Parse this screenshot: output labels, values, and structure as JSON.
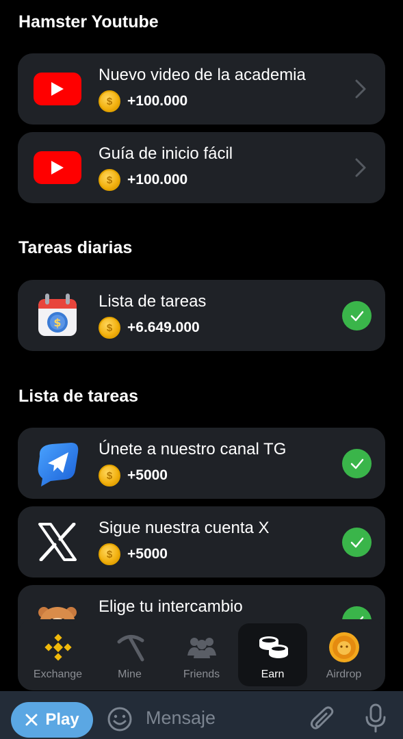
{
  "sections": {
    "youtube": {
      "title": "Hamster Youtube"
    },
    "daily": {
      "title": "Tareas diarias"
    },
    "tasks": {
      "title": "Lista de tareas"
    }
  },
  "cards": [
    {
      "title": "Nuevo video de la academia",
      "reward": "+100.000",
      "icon": "youtube-icon",
      "status": "chevron"
    },
    {
      "title": "Guía de inicio fácil",
      "reward": "+100.000",
      "icon": "youtube-icon",
      "status": "chevron"
    },
    {
      "title": "Lista de tareas",
      "reward": "+6.649.000",
      "icon": "calendar-coin-icon",
      "status": "done"
    },
    {
      "title": "Únete a nuestro canal TG",
      "reward": "+5000",
      "icon": "telegram-icon",
      "status": "done"
    },
    {
      "title": "Sigue nuestra cuenta X",
      "reward": "+5000",
      "icon": "x-logo-icon",
      "status": "done"
    },
    {
      "title": "Elige tu intercambio",
      "reward": "",
      "icon": "hamster-icon",
      "status": "done"
    }
  ],
  "coin_symbol": "$",
  "nav": {
    "items": [
      {
        "label": "Exchange",
        "icon": "binance-icon"
      },
      {
        "label": "Mine",
        "icon": "pickaxe-icon"
      },
      {
        "label": "Friends",
        "icon": "friends-icon"
      },
      {
        "label": "Earn",
        "icon": "coins-icon",
        "active": true
      },
      {
        "label": "Airdrop",
        "icon": "airdrop-coin-icon"
      }
    ]
  },
  "telegram": {
    "play_label": "Play",
    "message_placeholder": "Mensaje"
  },
  "colors": {
    "background": "#000000",
    "card": "#1f2227",
    "check": "#3ab54a",
    "youtube": "#ff0000",
    "coin": "#f2b110",
    "play_button": "#5ba7e3",
    "tg_bar": "#232c38"
  }
}
